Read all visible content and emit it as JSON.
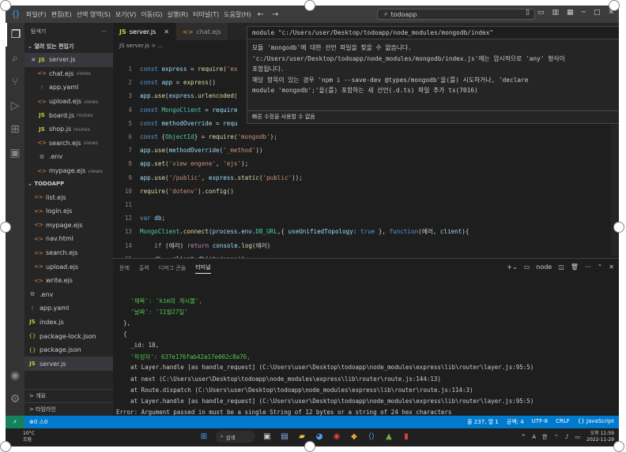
{
  "menu": [
    "파일(F)",
    "편집(E)",
    "선택 영역(S)",
    "보기(V)",
    "이동(G)",
    "실행(R)",
    "터미널(T)",
    "도움말(H)"
  ],
  "title_search": "todoapp",
  "sidebar": {
    "header": "탐색기",
    "open_editors_label": "열려 있는 편집기",
    "open_editors": [
      {
        "prefix": "×",
        "icon": "JS",
        "name": "server.js",
        "sub": ""
      },
      {
        "prefix": "",
        "icon": "<>",
        "name": "chat.ejs",
        "sub": "views"
      },
      {
        "prefix": "",
        "icon": "!",
        "name": "app.yaml",
        "sub": ""
      },
      {
        "prefix": "",
        "icon": "<>",
        "name": "upload.ejs",
        "sub": "views"
      },
      {
        "prefix": "",
        "icon": "JS",
        "name": "board.js",
        "sub": "routes"
      },
      {
        "prefix": "",
        "icon": "JS",
        "name": "shop.js",
        "sub": "routes"
      },
      {
        "prefix": "",
        "icon": "<>",
        "name": "search.ejs",
        "sub": "views"
      },
      {
        "prefix": "",
        "icon": "⚙",
        "name": ".env",
        "sub": ""
      },
      {
        "prefix": "",
        "icon": "<>",
        "name": "mypage.ejs",
        "sub": "views"
      }
    ],
    "project_label": "TODOAPP",
    "project_files": [
      {
        "icon": "<>",
        "name": "list.ejs"
      },
      {
        "icon": "<>",
        "name": "login.ejs"
      },
      {
        "icon": "<>",
        "name": "mypage.ejs"
      },
      {
        "icon": "<>",
        "name": "nav.html"
      },
      {
        "icon": "<>",
        "name": "search.ejs"
      },
      {
        "icon": "<>",
        "name": "upload.ejs"
      },
      {
        "icon": "<>",
        "name": "write.ejs"
      },
      {
        "icon": "⚙",
        "name": ".env"
      },
      {
        "icon": "!",
        "name": "app.yaml"
      },
      {
        "icon": "JS",
        "name": "index.js"
      },
      {
        "icon": "{}",
        "name": "package-lock.json"
      },
      {
        "icon": "{}",
        "name": "package.json"
      },
      {
        "icon": "JS",
        "name": "server.js"
      }
    ],
    "footer": [
      "> 개요",
      "> 타임라인"
    ]
  },
  "tabs": [
    {
      "icon": "JS",
      "label": "server.js",
      "active": true
    },
    {
      "icon": "<>",
      "label": "chat.ejs",
      "active": false
    }
  ],
  "breadcrumb": "JS server.js > ...",
  "code_lines": [
    {
      "n": "1",
      "t": "const express = require('ex"
    },
    {
      "n": "2",
      "t": "const app = express()"
    },
    {
      "n": "3",
      "t": "app.use(express.urlencoded("
    },
    {
      "n": "4",
      "t": "const MongoClient = require"
    },
    {
      "n": "5",
      "t": "const methodOverride = requ"
    },
    {
      "n": "6",
      "t": "const {ObjectId} = require('mongodb');"
    },
    {
      "n": "7",
      "t": "app.use(methodOverride('_method'))"
    },
    {
      "n": "8",
      "t": "app.set('view engene', 'ejs');"
    },
    {
      "n": "9",
      "t": "app.use('/public', express.static('public'));"
    },
    {
      "n": "10",
      "t": "require('dotenv').config()"
    },
    {
      "n": "11",
      "t": ""
    },
    {
      "n": "12",
      "t": "var db;"
    },
    {
      "n": "13",
      "t": "MongoClient.connect(process.env.DB_URL,{ useUnifiedTopology: true }, function(에러, client){"
    },
    {
      "n": "14",
      "t": "    if (에러) return console.log(에러)"
    },
    {
      "n": "15",
      "t": "    db = client.db('todoapp');"
    },
    {
      "n": "16",
      "t": "});"
    }
  ],
  "hover": {
    "header": "module \"c:/Users/user/Desktop/todoapp/node_modules/mongodb/index\"",
    "body": [
      "모듈 'mongodb'에 대한 선언 파일을 찾을 수 없습니다.",
      "'c:/Users/user/Desktop/todoapp/node_modules/mongodb/index.js'에는 암시적으로 'any' 형식이",
      "포함됩니다.",
      "  해당 항목이 있는 경우 'npm i --save-dev @types/mongodb'을(를) 시도하거나, 'declare",
      "module 'mongodb';'을(를) 포함하는 새 선언(.d.ts) 파일 추가 ts(7016)"
    ],
    "quick_fix": "빠른 수정을 사용할 수 없음"
  },
  "panel": {
    "tabs": [
      "문제",
      "출력",
      "디버그 콘솔",
      "터미널"
    ],
    "active_tab": "터미널",
    "shell": "node",
    "lines": [
      "",
      "    '제목': 'kim의 게시물',",
      "    '날짜': '11월27일'",
      "  },",
      "  {",
      "    _id: 18,",
      "    '작성자': 637e176fab42a17e002c8a76,",
      "    at Layer.handle [as handle_request] (C:\\Users\\user\\Desktop\\todoapp\\node_modules\\express\\lib\\router\\layer.js:95:5)",
      "    at next (C:\\Users\\user\\Desktop\\todoapp\\node_modules\\express\\lib\\router\\route.js:144:13)",
      "    at Route.dispatch (C:\\Users\\user\\Desktop\\todoapp\\node_modules\\express\\lib\\router\\route.js:114:3)",
      "    at Layer.handle [as handle_request] (C:\\Users\\user\\Desktop\\todoapp\\node_modules\\express\\lib\\router\\layer.js:95:5)",
      "Error: Argument passed in must be a single String of 12 bytes or a string of 24 hex characters",
      "    at new ObjectID (C:\\Users\\user\\Desktop\\todoapp\\node_modules\\bson\\lib\\bson\\objectid.js:59:11)",
      "    at ObjectID (C:\\Users\\user\\Desktop\\todoapp\\node_modules\\bson\\lib\\bson\\objectid.js:40:43)"
    ]
  },
  "status": {
    "left": "⊗0 ⚠0",
    "right": [
      "줄 237, 열 1",
      "공백: 4",
      "UTF-8",
      "CRLF",
      "{} JavaScript"
    ]
  },
  "taskbar": {
    "temp": "10°C",
    "weather": "흐림",
    "search": "검색",
    "tray": [
      "^",
      "A",
      "한"
    ],
    "time": "오후 11:59",
    "date": "2022-11-29"
  }
}
